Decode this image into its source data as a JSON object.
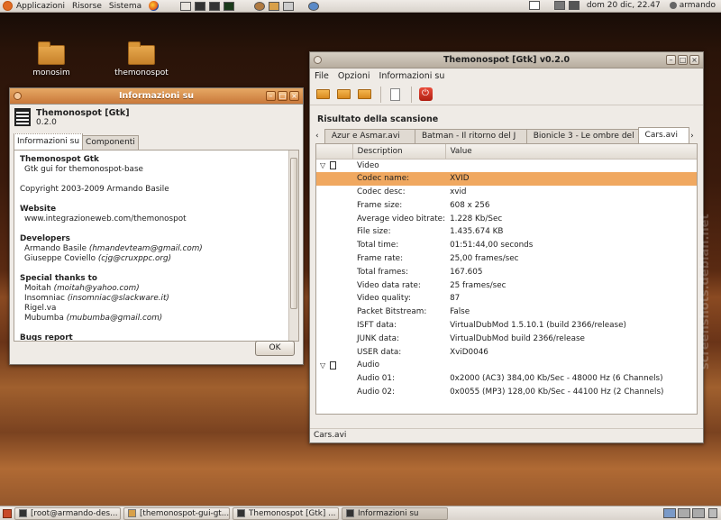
{
  "top_panel": {
    "menus": [
      "Applicazioni",
      "Risorse",
      "Sistema"
    ],
    "clock": "dom 20 dic, 22.47",
    "user": "armando"
  },
  "desktop_icons": [
    {
      "label": "monosim"
    },
    {
      "label": "themonospot"
    }
  ],
  "main_window": {
    "title": "Themonospot [Gtk] v0.2.0",
    "menu": [
      "File",
      "Opzioni",
      "Informazioni su"
    ],
    "section_title": "Risultato della scansione",
    "tabs": [
      "Azur e Asmar.avi",
      "Batman - Il ritorno del J",
      "Bionicle 3 - Le ombre del",
      "Cars.avi"
    ],
    "columns": [
      "Description",
      "Value"
    ],
    "video_group": "Video",
    "video_rows": [
      {
        "label": "Codec name:",
        "value": "XVID"
      },
      {
        "label": "Codec desc:",
        "value": "xvid"
      },
      {
        "label": "Frame size:",
        "value": "608 x 256"
      },
      {
        "label": "Average video bitrate:",
        "value": "1.228 Kb/Sec"
      },
      {
        "label": "File size:",
        "value": "1.435.674 KB"
      },
      {
        "label": "Total time:",
        "value": "01:51:44,00 seconds"
      },
      {
        "label": "Frame rate:",
        "value": "25,00 frames/sec"
      },
      {
        "label": "Total frames:",
        "value": "167.605"
      },
      {
        "label": "Video data rate:",
        "value": "25 frames/sec"
      },
      {
        "label": "Video quality:",
        "value": "87"
      },
      {
        "label": "Packet Bitstream:",
        "value": "False"
      },
      {
        "label": "ISFT data:",
        "value": "VirtualDubMod 1.5.10.1 (build 2366/release)"
      },
      {
        "label": "JUNK data:",
        "value": "VirtualDubMod build 2366/release"
      },
      {
        "label": "USER data:",
        "value": "XviD0046"
      }
    ],
    "audio_group": "Audio",
    "audio_rows": [
      {
        "label": "Audio 01:",
        "value": "0x2000 (AC3) 384,00 Kb/Sec - 48000 Hz (6 Channels)"
      },
      {
        "label": "Audio 02:",
        "value": "0x0055 (MP3) 128,00 Kb/Sec - 44100 Hz (2 Channels)"
      }
    ],
    "statusbar": "Cars.avi"
  },
  "about_dialog": {
    "title": "Informazioni su",
    "app_name": "Themonospot [Gtk]",
    "version": "0.2.0",
    "tabs": [
      "Informazioni su",
      "Componenti"
    ],
    "heading": "Themonospot Gtk",
    "subtitle": "Gtk gui for themonospot-base",
    "copyright": "Copyright 2003-2009 Armando Basile",
    "website_title": "Website",
    "website": "www.integrazioneweb.com/themonospot",
    "developers_title": "Developers",
    "developers": [
      {
        "name": "Armando Basile",
        "email": "(hmandevteam@gmail.com)"
      },
      {
        "name": "Giuseppe Coviello",
        "email": "(cjg@cruxppc.org)"
      }
    ],
    "thanks_title": "Special thanks to",
    "thanks": [
      {
        "name": "Moitah",
        "email": "(moitah@yahoo.com)"
      },
      {
        "name": "Insomniac",
        "email": "(insomniac@slackware.it)"
      },
      {
        "name": "Rigel.va",
        "email": ""
      },
      {
        "name": "Mubumba",
        "email": "(mubumba@gmail.com)"
      }
    ],
    "bugs_title": "Bugs report",
    "ok_label": "OK"
  },
  "taskbar": [
    "[root@armando-des...",
    "[themonospot-gui-gt...",
    "Themonospot [Gtk] ...",
    "Informazioni su"
  ],
  "watermark": "screenshots.debian.net"
}
